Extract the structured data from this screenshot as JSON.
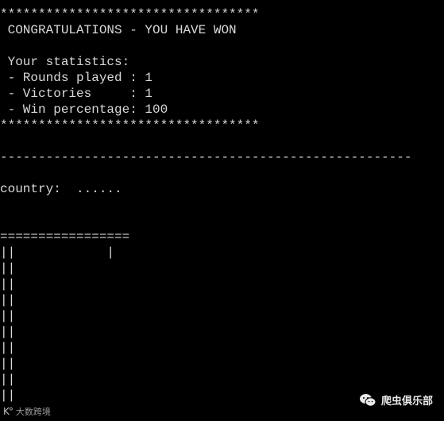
{
  "terminal": {
    "lines": [
      "**********************************",
      " CONGRATULATIONS - YOU HAVE WON",
      "",
      " Your statistics:",
      " - Rounds played : 1",
      " - Victories     : 1",
      " - Win percentage: 100",
      "**********************************",
      "",
      "------------------------------------------------------",
      "",
      "country:  ......",
      "",
      "",
      "=================",
      "||            |",
      "||",
      "||",
      "||",
      "||",
      "||",
      "||",
      "||",
      "||",
      "||"
    ]
  },
  "watermark": {
    "left_text": "大数跨境",
    "left_logo": "K°",
    "right_text": "爬虫俱乐部",
    "right_icon": "wechat-icon"
  },
  "colors": {
    "background": "#000000",
    "text": "#d9d9d9"
  }
}
